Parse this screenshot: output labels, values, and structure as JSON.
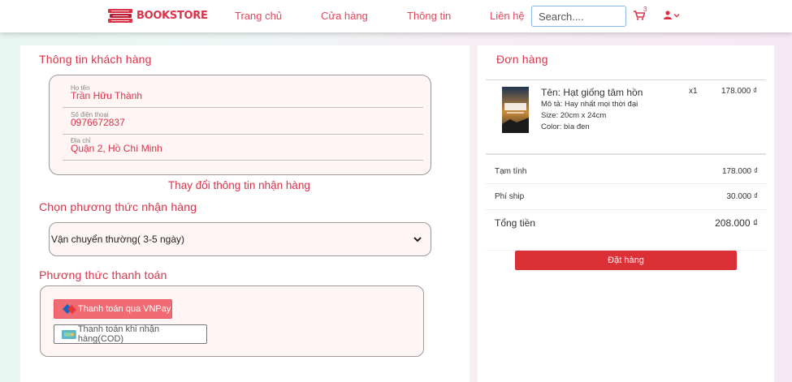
{
  "header": {
    "logo_text": "BOOKSTORE",
    "nav": [
      "Trang chủ",
      "Cửa hàng",
      "Thông tin",
      "Liên hệ"
    ],
    "search_placeholder": "Search....",
    "cart_count": "3"
  },
  "customer": {
    "title": "Thông tin khách hàng",
    "fields": [
      {
        "label": "Họ tên",
        "value": "Trần Hữu Thành"
      },
      {
        "label": "Số điện thoại",
        "value": "0976672837"
      },
      {
        "label": "Địa chỉ",
        "value": "Quận 2, Hồ Chí Minh"
      }
    ],
    "change_label": "Thay đổi thông tin nhận hàng"
  },
  "delivery": {
    "title": "Chọn phương thức nhận hàng",
    "selected": "Vận chuyển thường( 3-5 ngày)"
  },
  "payment": {
    "title": "Phương thức thanh toán",
    "vnpay_label": "Thanh toán qua VNPay",
    "cod_label": "Thanh toán khi nhận hàng(COD)"
  },
  "order": {
    "title": "Đơn hàng",
    "product": {
      "name": "Tên: Hạt giống tâm hồn",
      "description": "Mô tả: Hay nhất mọi thời đại",
      "size": "Size: 20cm x 24cm",
      "color": "Color: bìa đen",
      "quantity": "x1",
      "price": "178.000 ₫"
    },
    "subtotal_label": "Tạm tính",
    "subtotal_value": "178.000 ₫",
    "shipping_label": "Phí ship",
    "shipping_value": "30.000 ₫",
    "total_label": "Tổng tiền",
    "total_value": "208.000 ₫",
    "submit_label": "Đặt hàng"
  },
  "colors": {
    "accent": "#d9334a",
    "button_red": "#dc3037",
    "vnpay_pink": "#f06b74",
    "box_bg": "#fff5f5"
  }
}
